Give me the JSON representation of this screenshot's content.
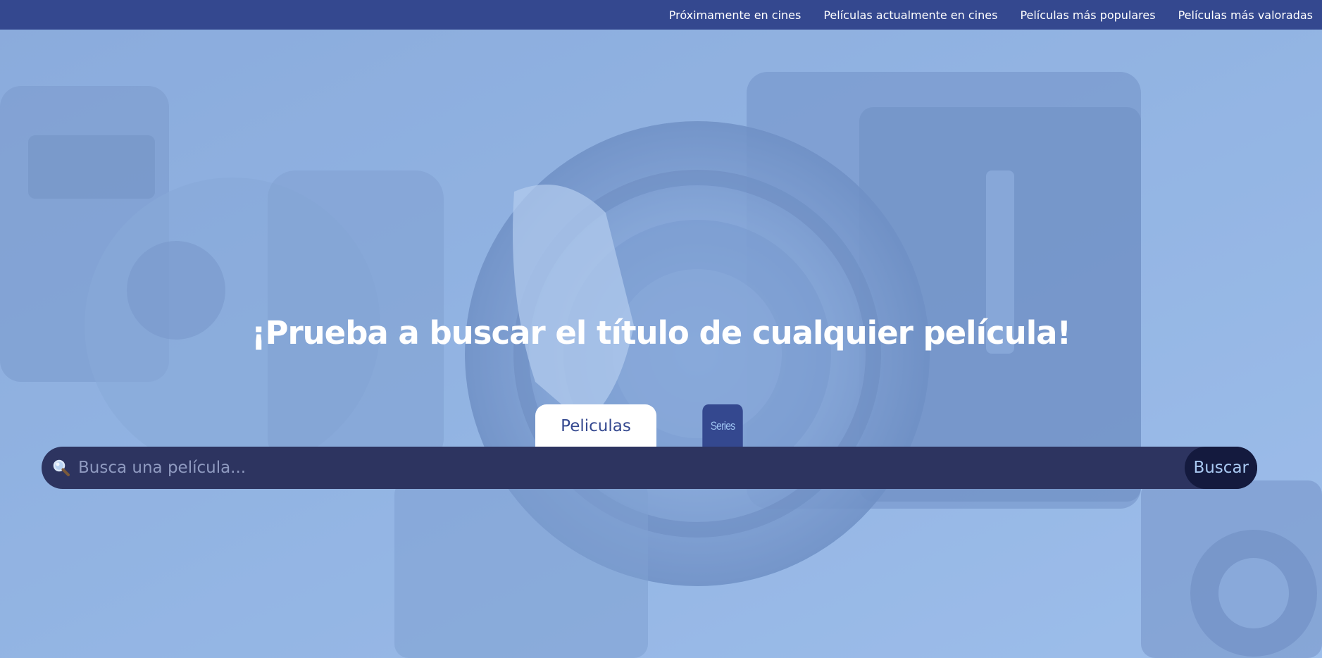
{
  "nav": {
    "items": [
      {
        "label": "Próximamente en cines"
      },
      {
        "label": "Películas actualmente en cines"
      },
      {
        "label": "Películas más populares"
      },
      {
        "label": "Películas más valoradas"
      }
    ]
  },
  "hero": {
    "title": "¡Prueba a buscar el título de cualquier película!"
  },
  "tabs": {
    "movies_label": "Peliculas",
    "series_label": "Series"
  },
  "search": {
    "placeholder": "Busca una película...",
    "value": "",
    "button_label": "Buscar",
    "icon": "magnifying-glass-icon"
  },
  "colors": {
    "nav_background": "#34488f",
    "search_bar": "#2d3460",
    "search_button": "#141a3e",
    "hero_tint": "#8db0e0"
  }
}
